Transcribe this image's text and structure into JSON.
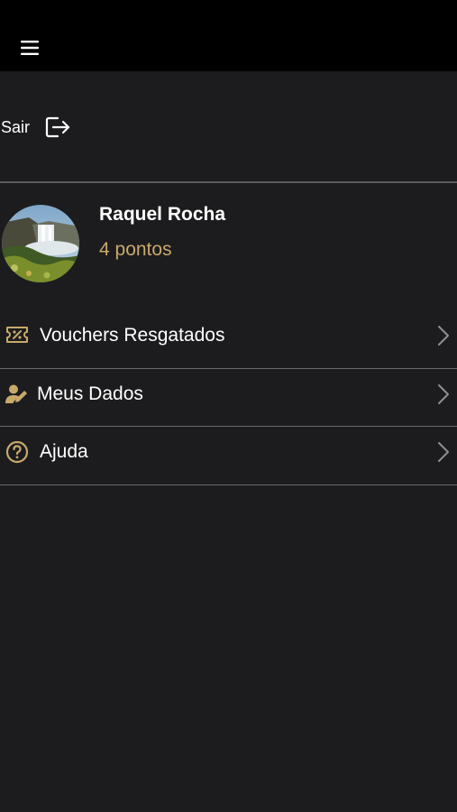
{
  "header": {
    "menu_icon": "hamburger-menu-icon"
  },
  "logout": {
    "label": "Sair",
    "icon": "logout-icon"
  },
  "profile": {
    "name": "Raquel Rocha",
    "points": "4 pontos",
    "avatar": "waterfall-landscape-photo"
  },
  "menu": {
    "items": [
      {
        "label": "Vouchers Resgatados",
        "icon": "ticket-percent-icon"
      },
      {
        "label": "Meus Dados",
        "icon": "user-edit-icon"
      },
      {
        "label": "Ajuda",
        "icon": "help-circle-icon"
      }
    ]
  },
  "colors": {
    "background": "#1c1c1e",
    "topbar": "#000000",
    "accent": "#c8a96b",
    "divider": "#5a5a5c",
    "chevron": "#8e8e93"
  }
}
